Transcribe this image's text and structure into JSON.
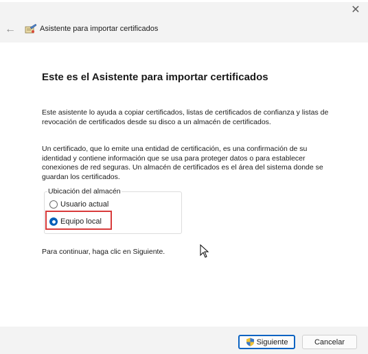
{
  "window": {
    "title": "Asistente para importar certificados",
    "close_glyph": "✕",
    "back_glyph": "←"
  },
  "main": {
    "heading": "Este es el Asistente para importar certificados",
    "paragraph1": "Este asistente lo ayuda a copiar certificados, listas de certificados de confianza y listas de revocación de certificados desde su disco a un almacén de certificados.",
    "paragraph2": "Un certificado, que lo emite una entidad de certificación, es una confirmación de su identidad y contiene información que se usa para proteger datos o para establecer conexiones de red seguras. Un almacén de certificados es el área del sistema donde se guardan los certificados.",
    "store_location": {
      "legend": "Ubicación del almacén",
      "options": [
        {
          "label": "Usuario actual",
          "selected": false
        },
        {
          "label": "Equipo local",
          "selected": true
        }
      ]
    },
    "continue_text": "Para continuar, haga clic en Siguiente."
  },
  "footer": {
    "next_label": "Siguiente",
    "cancel_label": "Cancelar"
  },
  "colors": {
    "accent": "#005fb8",
    "highlight": "#d83a3a",
    "titlebar": "#f3f3f3"
  },
  "icons": [
    "close-icon",
    "back-arrow-icon",
    "certificate-wizard-icon",
    "shield-icon",
    "mouse-cursor-icon"
  ]
}
